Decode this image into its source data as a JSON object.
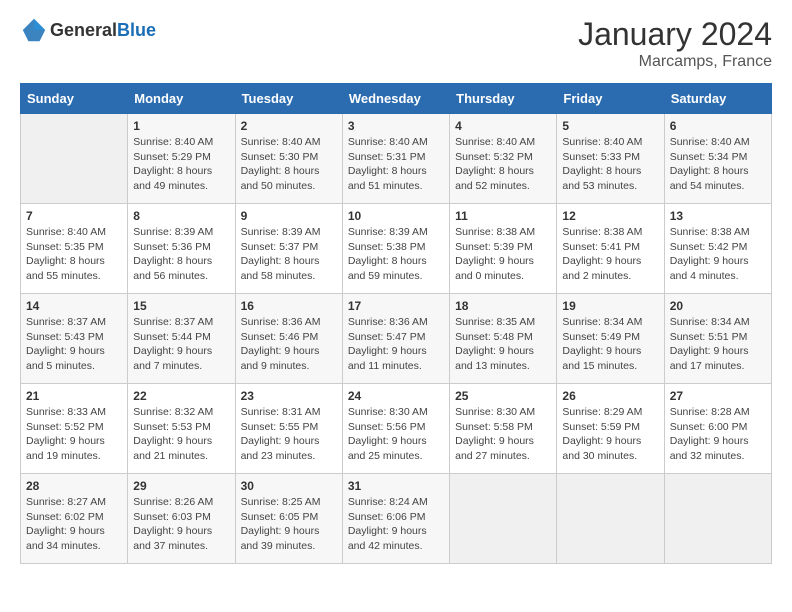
{
  "header": {
    "logo_general": "General",
    "logo_blue": "Blue",
    "month": "January 2024",
    "location": "Marcamps, France"
  },
  "weekdays": [
    "Sunday",
    "Monday",
    "Tuesday",
    "Wednesday",
    "Thursday",
    "Friday",
    "Saturday"
  ],
  "weeks": [
    [
      {
        "day": "",
        "sunrise": "",
        "sunset": "",
        "daylight": ""
      },
      {
        "day": "1",
        "sunrise": "Sunrise: 8:40 AM",
        "sunset": "Sunset: 5:29 PM",
        "daylight": "Daylight: 8 hours and 49 minutes."
      },
      {
        "day": "2",
        "sunrise": "Sunrise: 8:40 AM",
        "sunset": "Sunset: 5:30 PM",
        "daylight": "Daylight: 8 hours and 50 minutes."
      },
      {
        "day": "3",
        "sunrise": "Sunrise: 8:40 AM",
        "sunset": "Sunset: 5:31 PM",
        "daylight": "Daylight: 8 hours and 51 minutes."
      },
      {
        "day": "4",
        "sunrise": "Sunrise: 8:40 AM",
        "sunset": "Sunset: 5:32 PM",
        "daylight": "Daylight: 8 hours and 52 minutes."
      },
      {
        "day": "5",
        "sunrise": "Sunrise: 8:40 AM",
        "sunset": "Sunset: 5:33 PM",
        "daylight": "Daylight: 8 hours and 53 minutes."
      },
      {
        "day": "6",
        "sunrise": "Sunrise: 8:40 AM",
        "sunset": "Sunset: 5:34 PM",
        "daylight": "Daylight: 8 hours and 54 minutes."
      }
    ],
    [
      {
        "day": "7",
        "sunrise": "Sunrise: 8:40 AM",
        "sunset": "Sunset: 5:35 PM",
        "daylight": "Daylight: 8 hours and 55 minutes."
      },
      {
        "day": "8",
        "sunrise": "Sunrise: 8:39 AM",
        "sunset": "Sunset: 5:36 PM",
        "daylight": "Daylight: 8 hours and 56 minutes."
      },
      {
        "day": "9",
        "sunrise": "Sunrise: 8:39 AM",
        "sunset": "Sunset: 5:37 PM",
        "daylight": "Daylight: 8 hours and 58 minutes."
      },
      {
        "day": "10",
        "sunrise": "Sunrise: 8:39 AM",
        "sunset": "Sunset: 5:38 PM",
        "daylight": "Daylight: 8 hours and 59 minutes."
      },
      {
        "day": "11",
        "sunrise": "Sunrise: 8:38 AM",
        "sunset": "Sunset: 5:39 PM",
        "daylight": "Daylight: 9 hours and 0 minutes."
      },
      {
        "day": "12",
        "sunrise": "Sunrise: 8:38 AM",
        "sunset": "Sunset: 5:41 PM",
        "daylight": "Daylight: 9 hours and 2 minutes."
      },
      {
        "day": "13",
        "sunrise": "Sunrise: 8:38 AM",
        "sunset": "Sunset: 5:42 PM",
        "daylight": "Daylight: 9 hours and 4 minutes."
      }
    ],
    [
      {
        "day": "14",
        "sunrise": "Sunrise: 8:37 AM",
        "sunset": "Sunset: 5:43 PM",
        "daylight": "Daylight: 9 hours and 5 minutes."
      },
      {
        "day": "15",
        "sunrise": "Sunrise: 8:37 AM",
        "sunset": "Sunset: 5:44 PM",
        "daylight": "Daylight: 9 hours and 7 minutes."
      },
      {
        "day": "16",
        "sunrise": "Sunrise: 8:36 AM",
        "sunset": "Sunset: 5:46 PM",
        "daylight": "Daylight: 9 hours and 9 minutes."
      },
      {
        "day": "17",
        "sunrise": "Sunrise: 8:36 AM",
        "sunset": "Sunset: 5:47 PM",
        "daylight": "Daylight: 9 hours and 11 minutes."
      },
      {
        "day": "18",
        "sunrise": "Sunrise: 8:35 AM",
        "sunset": "Sunset: 5:48 PM",
        "daylight": "Daylight: 9 hours and 13 minutes."
      },
      {
        "day": "19",
        "sunrise": "Sunrise: 8:34 AM",
        "sunset": "Sunset: 5:49 PM",
        "daylight": "Daylight: 9 hours and 15 minutes."
      },
      {
        "day": "20",
        "sunrise": "Sunrise: 8:34 AM",
        "sunset": "Sunset: 5:51 PM",
        "daylight": "Daylight: 9 hours and 17 minutes."
      }
    ],
    [
      {
        "day": "21",
        "sunrise": "Sunrise: 8:33 AM",
        "sunset": "Sunset: 5:52 PM",
        "daylight": "Daylight: 9 hours and 19 minutes."
      },
      {
        "day": "22",
        "sunrise": "Sunrise: 8:32 AM",
        "sunset": "Sunset: 5:53 PM",
        "daylight": "Daylight: 9 hours and 21 minutes."
      },
      {
        "day": "23",
        "sunrise": "Sunrise: 8:31 AM",
        "sunset": "Sunset: 5:55 PM",
        "daylight": "Daylight: 9 hours and 23 minutes."
      },
      {
        "day": "24",
        "sunrise": "Sunrise: 8:30 AM",
        "sunset": "Sunset: 5:56 PM",
        "daylight": "Daylight: 9 hours and 25 minutes."
      },
      {
        "day": "25",
        "sunrise": "Sunrise: 8:30 AM",
        "sunset": "Sunset: 5:58 PM",
        "daylight": "Daylight: 9 hours and 27 minutes."
      },
      {
        "day": "26",
        "sunrise": "Sunrise: 8:29 AM",
        "sunset": "Sunset: 5:59 PM",
        "daylight": "Daylight: 9 hours and 30 minutes."
      },
      {
        "day": "27",
        "sunrise": "Sunrise: 8:28 AM",
        "sunset": "Sunset: 6:00 PM",
        "daylight": "Daylight: 9 hours and 32 minutes."
      }
    ],
    [
      {
        "day": "28",
        "sunrise": "Sunrise: 8:27 AM",
        "sunset": "Sunset: 6:02 PM",
        "daylight": "Daylight: 9 hours and 34 minutes."
      },
      {
        "day": "29",
        "sunrise": "Sunrise: 8:26 AM",
        "sunset": "Sunset: 6:03 PM",
        "daylight": "Daylight: 9 hours and 37 minutes."
      },
      {
        "day": "30",
        "sunrise": "Sunrise: 8:25 AM",
        "sunset": "Sunset: 6:05 PM",
        "daylight": "Daylight: 9 hours and 39 minutes."
      },
      {
        "day": "31",
        "sunrise": "Sunrise: 8:24 AM",
        "sunset": "Sunset: 6:06 PM",
        "daylight": "Daylight: 9 hours and 42 minutes."
      },
      {
        "day": "",
        "sunrise": "",
        "sunset": "",
        "daylight": ""
      },
      {
        "day": "",
        "sunrise": "",
        "sunset": "",
        "daylight": ""
      },
      {
        "day": "",
        "sunrise": "",
        "sunset": "",
        "daylight": ""
      }
    ]
  ]
}
